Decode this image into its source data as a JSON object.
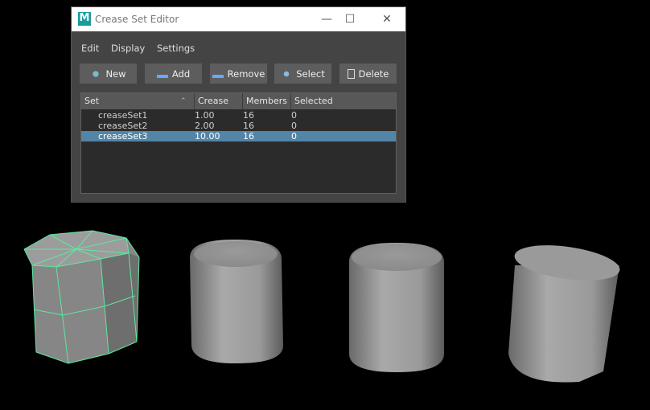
{
  "window": {
    "title": "Crease Set Editor",
    "logo": "M",
    "minimize": "—",
    "maximize": "☐",
    "close": "✕"
  },
  "menu": [
    "Edit",
    "Display",
    "Settings"
  ],
  "buttons": [
    {
      "label": "New",
      "icon": "new-set-icon"
    },
    {
      "label": "Add",
      "icon": "add-icon"
    },
    {
      "label": "Remove",
      "icon": "remove-icon"
    },
    {
      "label": "Select",
      "icon": "select-icon"
    },
    {
      "label": "Delete",
      "icon": "trash-icon"
    }
  ],
  "table": {
    "columns": [
      "Set",
      "Crease",
      "Members",
      "Selected"
    ],
    "sort_indicator": "⌃",
    "rows": [
      {
        "set": "creaseSet1",
        "crease": "1.00",
        "members": "16",
        "selected": "0"
      },
      {
        "set": "creaseSet2",
        "crease": "2.00",
        "members": "16",
        "selected": "0"
      },
      {
        "set": "creaseSet3",
        "crease": "10.00",
        "members": "16",
        "selected": "0",
        "highlighted": true
      }
    ]
  },
  "colors": {
    "selection": "#5285a6",
    "wireframe": "#5ee8a0"
  }
}
